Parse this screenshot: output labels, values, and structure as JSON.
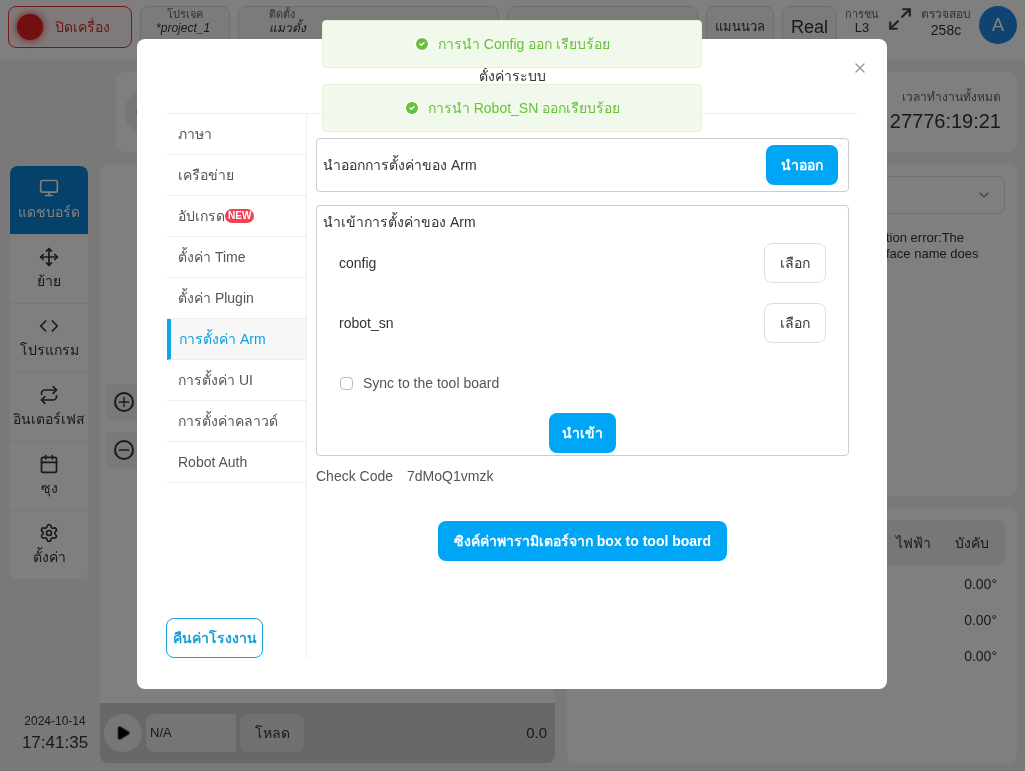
{
  "header": {
    "power_button": "ปิดเครื่อง",
    "chips": [
      {
        "label": "โปรเจค",
        "value": "*project_1"
      },
      {
        "label": "ติดตั้ง",
        "value": "แมวตั้ง"
      }
    ],
    "mode_buttons": [
      "แมนนวล",
      "Real"
    ],
    "collision": {
      "label": "การชน",
      "value": "L3"
    },
    "check": {
      "label": "ตรวจสอบ",
      "value": "258c"
    },
    "avatar": "A"
  },
  "nav": [
    {
      "label": "แดชบอร์ด",
      "selected": true
    },
    {
      "label": "ย้าย",
      "selected": false
    },
    {
      "label": "โปรแกรม",
      "selected": false
    },
    {
      "label": "อินเตอร์เฟส",
      "selected": false
    },
    {
      "label": "ซุง",
      "selected": false
    },
    {
      "label": "ตั้งค่า",
      "selected": false
    }
  ],
  "runtime": {
    "label": "เวลาทำงานทั้งหมด",
    "value": "27776:19:21"
  },
  "log": {
    "lines": [
      "tion error:The",
      "face name does"
    ]
  },
  "joints": {
    "headers": [
      "ไฟฟ้า",
      "บังคับ"
    ],
    "rows": [
      {
        "value": "0.00°"
      },
      {
        "value": "0.00°"
      },
      {
        "value": "0.00°"
      }
    ]
  },
  "footer": {
    "date": "2024-10-14",
    "time": "17:41:35",
    "program": "N/A",
    "load_button": "โหลด",
    "speed": "0.0"
  },
  "modal": {
    "title": "ตั้งค่าระบบ",
    "menu": [
      {
        "label": "ภาษา",
        "selected": false
      },
      {
        "label": "เครือข่าย",
        "selected": false
      },
      {
        "label": "อัปเกรด",
        "badge": "NEW",
        "selected": false
      },
      {
        "label": "ตั้งค่า Time",
        "selected": false
      },
      {
        "label": "ตั้งค่า Plugin",
        "selected": false
      },
      {
        "label": "การตั้งค่า Arm",
        "selected": true
      },
      {
        "label": "การตั้งค่า UI",
        "selected": false
      },
      {
        "label": "การตั้งค่าคลาวด์",
        "selected": false
      },
      {
        "label": "Robot Auth",
        "selected": false
      }
    ],
    "export": {
      "label": "นำออกการตั้งค่าของ Arm",
      "button": "นำออก"
    },
    "import": {
      "title": "นำเข้าการตั้งค่าของ Arm",
      "files": [
        {
          "name": "config",
          "button": "เลือก"
        },
        {
          "name": "robot_sn",
          "button": "เลือก"
        }
      ],
      "sync": {
        "label": "Sync to the tool board",
        "checked": false
      },
      "button": "นำเข้า"
    },
    "check_code": {
      "label": "Check Code",
      "value": "7dMoQ1vmzk"
    },
    "sync_button": "ซิงค์ค่าพารามิเตอร์จาก box to tool board",
    "reset_button": "คืนค่าโรงงาน"
  },
  "toasts": [
    {
      "text": "การนำ Config ออก เรียบร้อย"
    },
    {
      "text": "การนำ Robot_SN ออกเรียบร้อย"
    }
  ]
}
